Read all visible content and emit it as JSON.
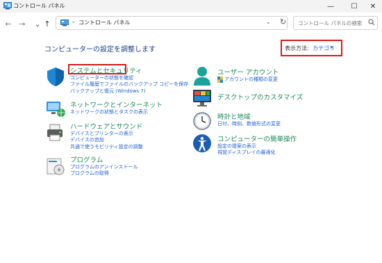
{
  "window": {
    "title": "コントロール パネル"
  },
  "window_controls": {
    "minimize": "—",
    "maximize": "☐",
    "close": "✕"
  },
  "nav": {
    "back": "←",
    "forward": "→",
    "up": "↑"
  },
  "address": {
    "separator": "›",
    "crumb": "コントロール パネル",
    "dropdown": "⌄",
    "refresh": "↻"
  },
  "search": {
    "placeholder": "コントロール パネルの検索"
  },
  "main": {
    "heading": "コンピューターの設定を調整します"
  },
  "view_by": {
    "label": "表示方法:",
    "value": "カテゴリ",
    "arrow": "▾"
  },
  "categories_left": [
    {
      "title": "システムとセキュリティ",
      "links": [
        "コンピューターの状態を確認",
        "ファイル履歴でファイルのバックアップ コピーを保存",
        "バックアップと復元 (Windows 7)"
      ]
    },
    {
      "title": "ネットワークとインターネット",
      "links": [
        "ネットワークの状態とタスクの表示"
      ]
    },
    {
      "title": "ハードウェアとサウンド",
      "links": [
        "デバイスとプリンターの表示",
        "デバイスの追加",
        "共通で使うモビリティ設定の調整"
      ]
    },
    {
      "title": "プログラム",
      "links": [
        "プログラムのアンインストール",
        "プログラムの取得"
      ]
    }
  ],
  "categories_right": [
    {
      "title": "ユーザー アカウント",
      "links": [
        "アカウントの種類の変更"
      ]
    },
    {
      "title": "デスクトップのカスタマイズ",
      "links": []
    },
    {
      "title": "時計と地域",
      "links": [
        "日付、時刻、数値形式の変更"
      ]
    },
    {
      "title": "コンピューターの簡単操作",
      "links": [
        "設定の提案の表示",
        "視覚ディスプレイの最適化"
      ]
    }
  ],
  "colors": {
    "accent": "#1f61d1",
    "category_green": "#1f8a5a",
    "highlight_red": "#d61a1a",
    "heading_blue": "#1a3f8a"
  }
}
